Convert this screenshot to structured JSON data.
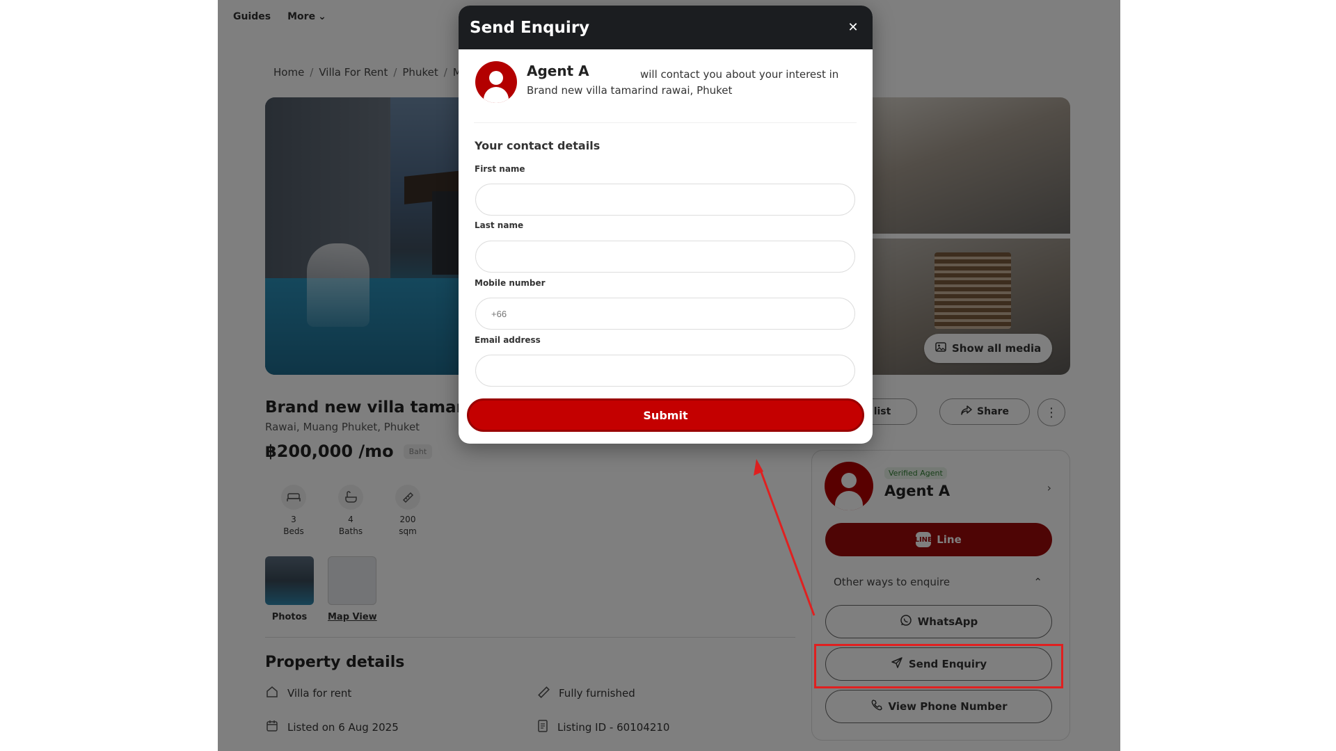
{
  "nav": {
    "guides": "Guides",
    "more": "More"
  },
  "breadcrumb": {
    "home": "Home",
    "villa_for_rent": "Villa For Rent",
    "phuket": "Phuket",
    "truncated": "M"
  },
  "listing": {
    "title": "Brand new villa tamarind rawai, Phuket",
    "location": "Rawai, Muang Phuket, Phuket",
    "price": "฿200,000 /mo",
    "currency_tag": "Baht",
    "specs": [
      {
        "value": "3",
        "label": "Beds"
      },
      {
        "value": "4",
        "label": "Baths"
      },
      {
        "value": "200",
        "label": "sqm"
      }
    ],
    "media": {
      "photos": "Photos",
      "map_view": "Map View",
      "show_all_media": "Show all media"
    },
    "actions": {
      "shortlist": "list",
      "share": "Share"
    }
  },
  "property_details": {
    "title": "Property details",
    "type": "Villa for rent",
    "furnishing": "Fully furnished",
    "listed": "Listed on 6 Aug 2025",
    "listing_id": "Listing ID - 60104210"
  },
  "agent_card": {
    "verified": "Verified Agent",
    "name": "Agent A",
    "line": "Line",
    "other_ways": "Other ways to enquire",
    "whatsapp": "WhatsApp",
    "send_enquiry": "Send Enquiry",
    "view_phone": "View Phone Number"
  },
  "modal": {
    "title": "Send Enquiry",
    "agent_name": "Agent A",
    "contact_text": "will contact you about your interest in",
    "property_name": "Brand new villa tamarind rawai, Phuket",
    "section_title": "Your contact details",
    "first_name_label": "First name",
    "last_name_label": "Last name",
    "mobile_label": "Mobile number",
    "mobile_placeholder": "+66",
    "email_label": "Email address",
    "submit": "Submit"
  },
  "colors": {
    "brand_red": "#c40000",
    "highlight_red": "#e02020",
    "header_dark": "#1b1d20"
  },
  "icons": [
    "close-icon",
    "bed-icon",
    "bath-icon",
    "area-icon",
    "share-icon",
    "more-icon",
    "media-icon",
    "line-icon",
    "whatsapp-icon",
    "send-icon",
    "phone-icon",
    "home-icon",
    "calendar-icon",
    "document-icon",
    "ruler-icon",
    "chevron-down-icon",
    "chevron-up-icon",
    "chevron-right-icon"
  ]
}
